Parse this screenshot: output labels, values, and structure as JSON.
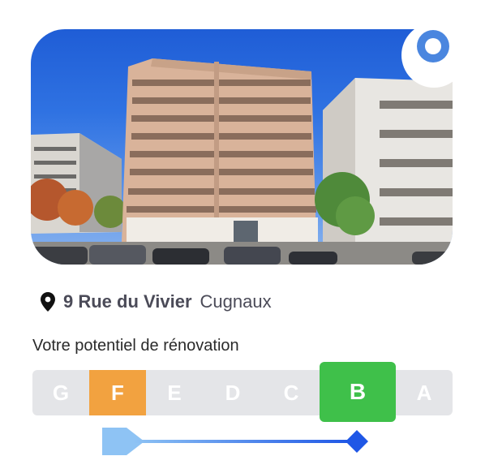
{
  "property": {
    "street": "9 Rue du Vivier",
    "city": "Cugnaux"
  },
  "heading": "Votre potentiel de rénovation",
  "energy_scale": {
    "classes": [
      {
        "letter": "G",
        "color": "#e4e5e8"
      },
      {
        "letter": "F",
        "color": "#f2a240"
      },
      {
        "letter": "E",
        "color": "#e4e5e8"
      },
      {
        "letter": "D",
        "color": "#e4e5e8"
      },
      {
        "letter": "C",
        "color": "#e4e5e8"
      },
      {
        "letter": "B",
        "color": "#3fc04a"
      },
      {
        "letter": "A",
        "color": "#e4e5e8"
      }
    ],
    "current_class": "F",
    "potential_class": "B"
  },
  "icons": {
    "location": "location-pin-icon",
    "badge": "map-pin-badge-icon"
  },
  "colors": {
    "accent_blue": "#4a86df",
    "arrow_start": "#8ec3f4",
    "arrow_end": "#1f57e6"
  }
}
